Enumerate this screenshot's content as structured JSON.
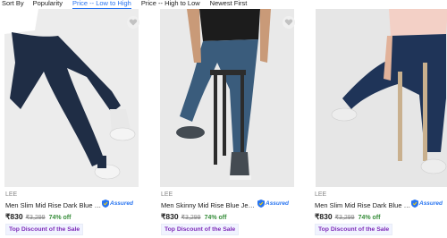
{
  "sort": {
    "label": "Sort By",
    "options": [
      "Popularity",
      "Price -- Low to High",
      "Price -- High to Low",
      "Newest First"
    ],
    "selected": "Price -- Low to High"
  },
  "products": [
    {
      "brand": "LEE",
      "title": "Men Slim Mid Rise Dark Blue Jeans",
      "assured": "Assured",
      "price": "₹830",
      "mrp": "₹3,299",
      "discount_pct": "74% off",
      "offer": "Top Discount of the Sale",
      "wishlist_icon": "heart-icon"
    },
    {
      "brand": "LEE",
      "title": "Men Skinny Mid Rise Blue Jeans",
      "assured": "Assured",
      "price": "₹830",
      "mrp": "₹3,299",
      "discount_pct": "74% off",
      "offer": "Top Discount of the Sale",
      "wishlist_icon": "heart-icon"
    },
    {
      "brand": "LEE",
      "title": "Men Slim Mid Rise Dark Blue Jeans",
      "assured": "Assured",
      "price": "₹830",
      "mrp": "₹3,299",
      "discount_pct": "74% off",
      "offer": "Top Discount of the Sale"
    }
  ],
  "colors": {
    "accent": "#2874f0",
    "discount_green": "#388e3c",
    "offer_purple": "#7e2ab8",
    "muted": "#878787"
  }
}
